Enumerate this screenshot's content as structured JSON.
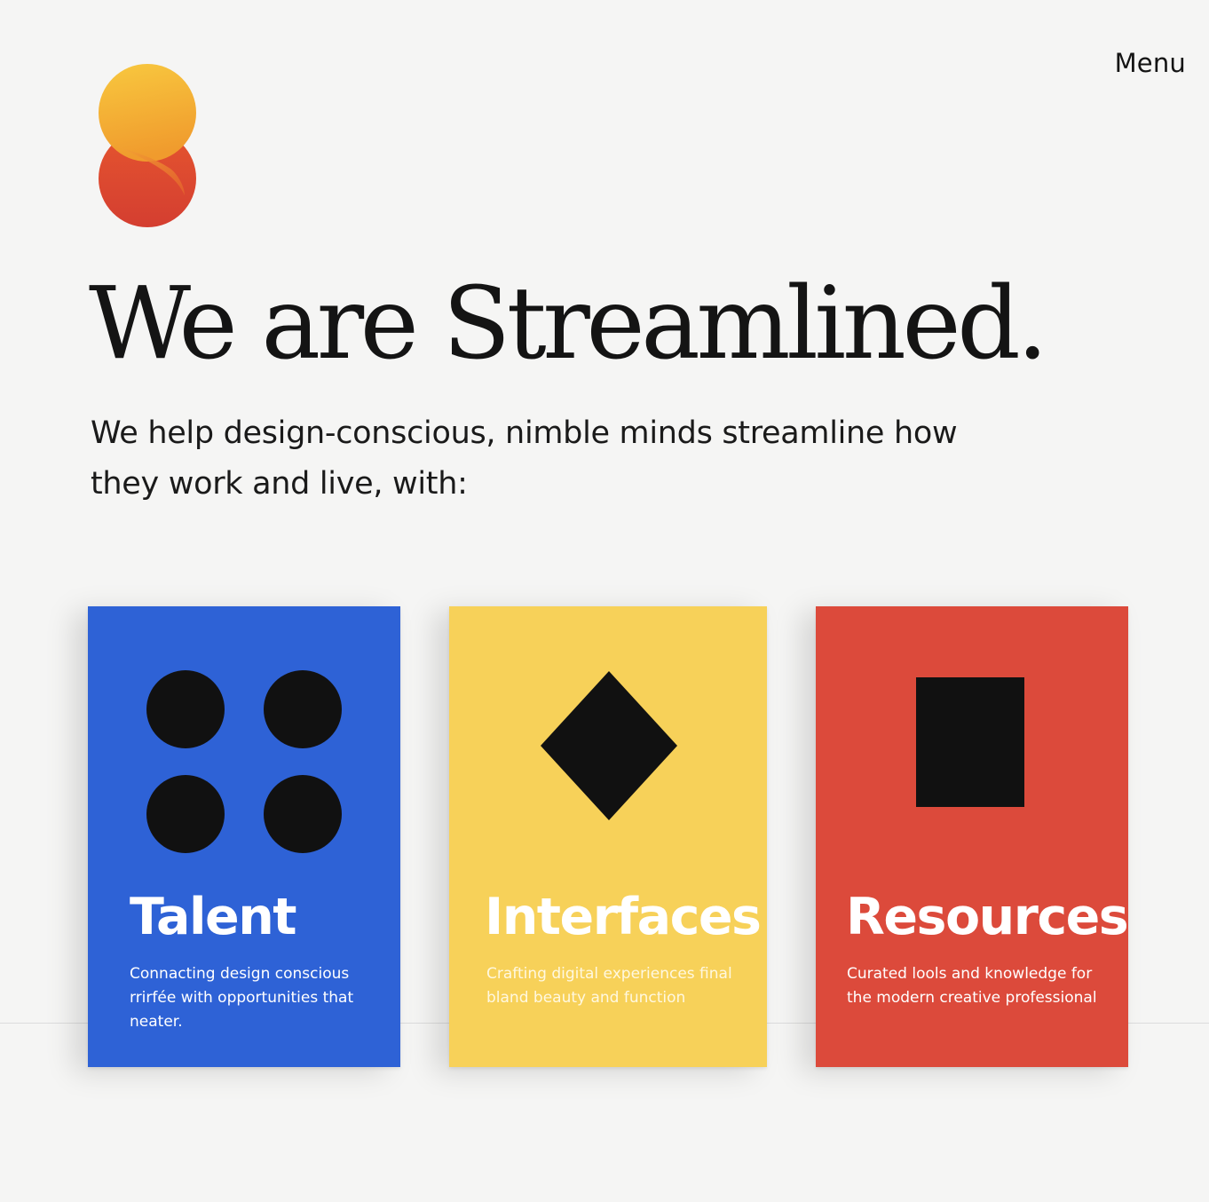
{
  "header": {
    "menu_label": "Menu",
    "logo_icon": "s-logo-icon"
  },
  "hero": {
    "title": "We are Streamlined.",
    "intro": "We help design-conscious, nimble minds streamline how they work and live, with:"
  },
  "cards": [
    {
      "title": "Talent",
      "description": "Connacting design conscious rrirfée with opportunities that neater.",
      "icon": "four-dots-icon",
      "color": "#2e62d6"
    },
    {
      "title": "Interfaces",
      "description": "Crafting digital experiences final bland beauty and function",
      "icon": "diamond-icon",
      "color": "#f7d159"
    },
    {
      "title": "Resources",
      "description": "Curated lools and knowledge for the modern creative professional",
      "icon": "square-icon",
      "color": "#dc4a3b"
    }
  ],
  "colors": {
    "background": "#f5f5f4",
    "text": "#141414",
    "logo_top": "#f8c83f",
    "logo_bottom": "#d9412f"
  }
}
